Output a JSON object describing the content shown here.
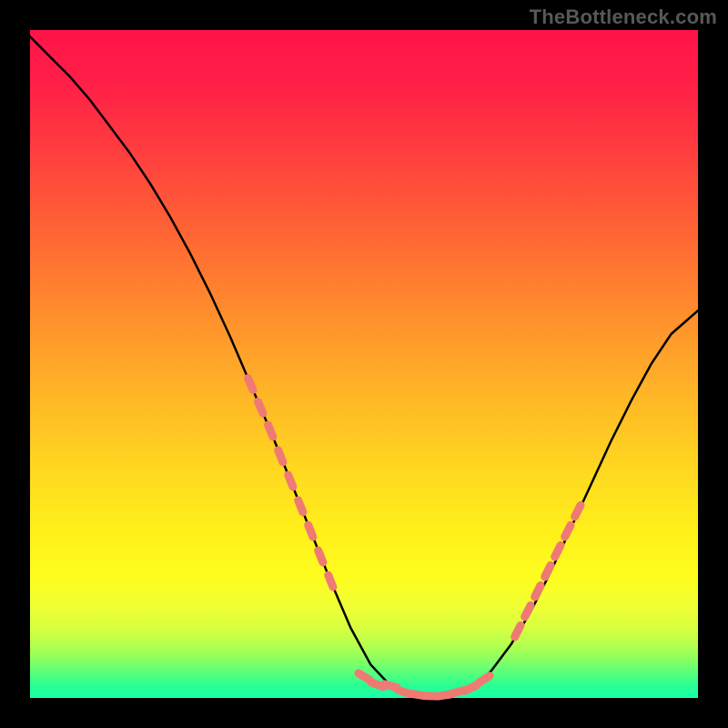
{
  "watermark": "TheBottleneck.com",
  "chart_data": {
    "type": "line",
    "title": "",
    "xlabel": "",
    "ylabel": "",
    "xlim": [
      0,
      100
    ],
    "ylim": [
      0,
      100
    ],
    "grid": false,
    "series": [
      {
        "name": "bottleneck-curve",
        "x": [
          0,
          3,
          6,
          9,
          12,
          15,
          18,
          21,
          24,
          27,
          30,
          33,
          36,
          39,
          42,
          45,
          48,
          51,
          54,
          57,
          60,
          63,
          66,
          69,
          72,
          75,
          78,
          81,
          84,
          87,
          90,
          93,
          96,
          100
        ],
        "y": [
          99,
          96,
          93,
          89.5,
          85.5,
          81.5,
          77,
          72,
          66.5,
          60.5,
          54,
          47,
          40,
          32.5,
          25,
          17.5,
          10.5,
          5,
          1.8,
          0.5,
          0.3,
          0.5,
          1.5,
          4,
          8,
          13,
          19,
          25.5,
          32,
          38.5,
          44.5,
          50,
          54.5,
          58
        ],
        "color": "#000000"
      }
    ],
    "highlight_segments": [
      {
        "name": "left-shoulder-dashes",
        "color": "#ef7a74",
        "points_x": [
          33,
          34.5,
          36,
          37.5,
          39,
          40.5,
          42,
          43.5,
          45
        ],
        "points_y": [
          47,
          43.5,
          40,
          36.2,
          32.5,
          28.7,
          25,
          21.2,
          17.5
        ]
      },
      {
        "name": "valley-dashes",
        "color": "#ef7a74",
        "points_x": [
          50,
          52,
          54,
          56,
          58,
          60,
          62,
          64,
          66,
          68
        ],
        "points_y": [
          3.2,
          2.0,
          1.8,
          0.9,
          0.5,
          0.3,
          0.4,
          0.9,
          1.5,
          2.8
        ]
      },
      {
        "name": "right-shoulder-dashes",
        "color": "#ef7a74",
        "points_x": [
          73,
          74.5,
          76,
          77.5,
          79,
          80.5,
          82
        ],
        "points_y": [
          10,
          13,
          16,
          19,
          22,
          25,
          28
        ]
      }
    ]
  }
}
